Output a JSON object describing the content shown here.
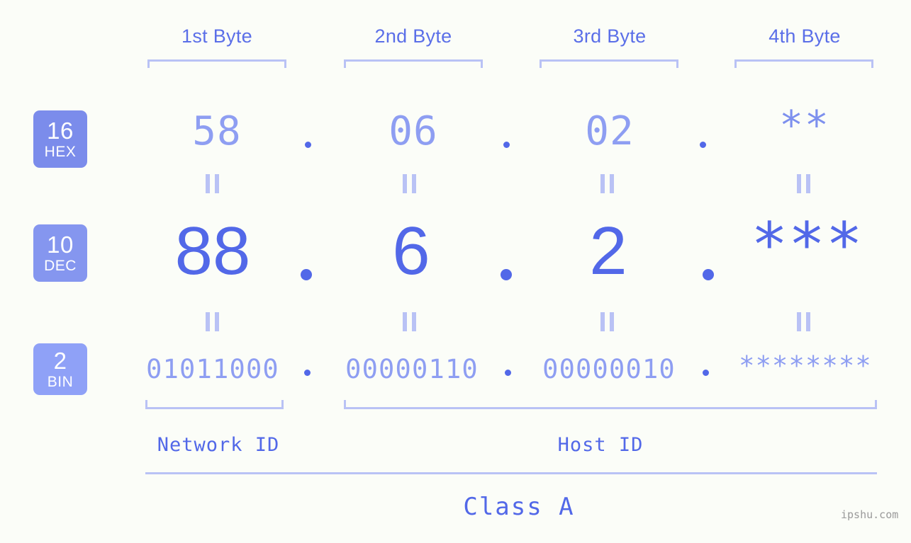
{
  "background_color": "#fbfdf8",
  "accent_color": "#5268e8",
  "accent_light_color": "#8e9ef2",
  "bracket_color": "#b9c2f5",
  "byte_headers": [
    {
      "label": "1st Byte"
    },
    {
      "label": "2nd Byte"
    },
    {
      "label": "3rd Byte"
    },
    {
      "label": "4th Byte"
    }
  ],
  "rows": {
    "hex": {
      "badge_number": "16",
      "badge_name": "HEX",
      "values": [
        "58",
        "06",
        "02",
        "**"
      ],
      "separator": "."
    },
    "dec": {
      "badge_number": "10",
      "badge_name": "DEC",
      "values": [
        "88",
        "6",
        "2",
        "***"
      ],
      "separator": "."
    },
    "bin": {
      "badge_number": "2",
      "badge_name": "BIN",
      "values": [
        "01011000",
        "00000110",
        "00000010",
        "********"
      ],
      "separator": "."
    }
  },
  "equals_marker": "=",
  "footer": {
    "network_id_label": "Network ID",
    "host_id_label": "Host ID",
    "class_label": "Class A"
  },
  "watermark": "ipshu.com"
}
